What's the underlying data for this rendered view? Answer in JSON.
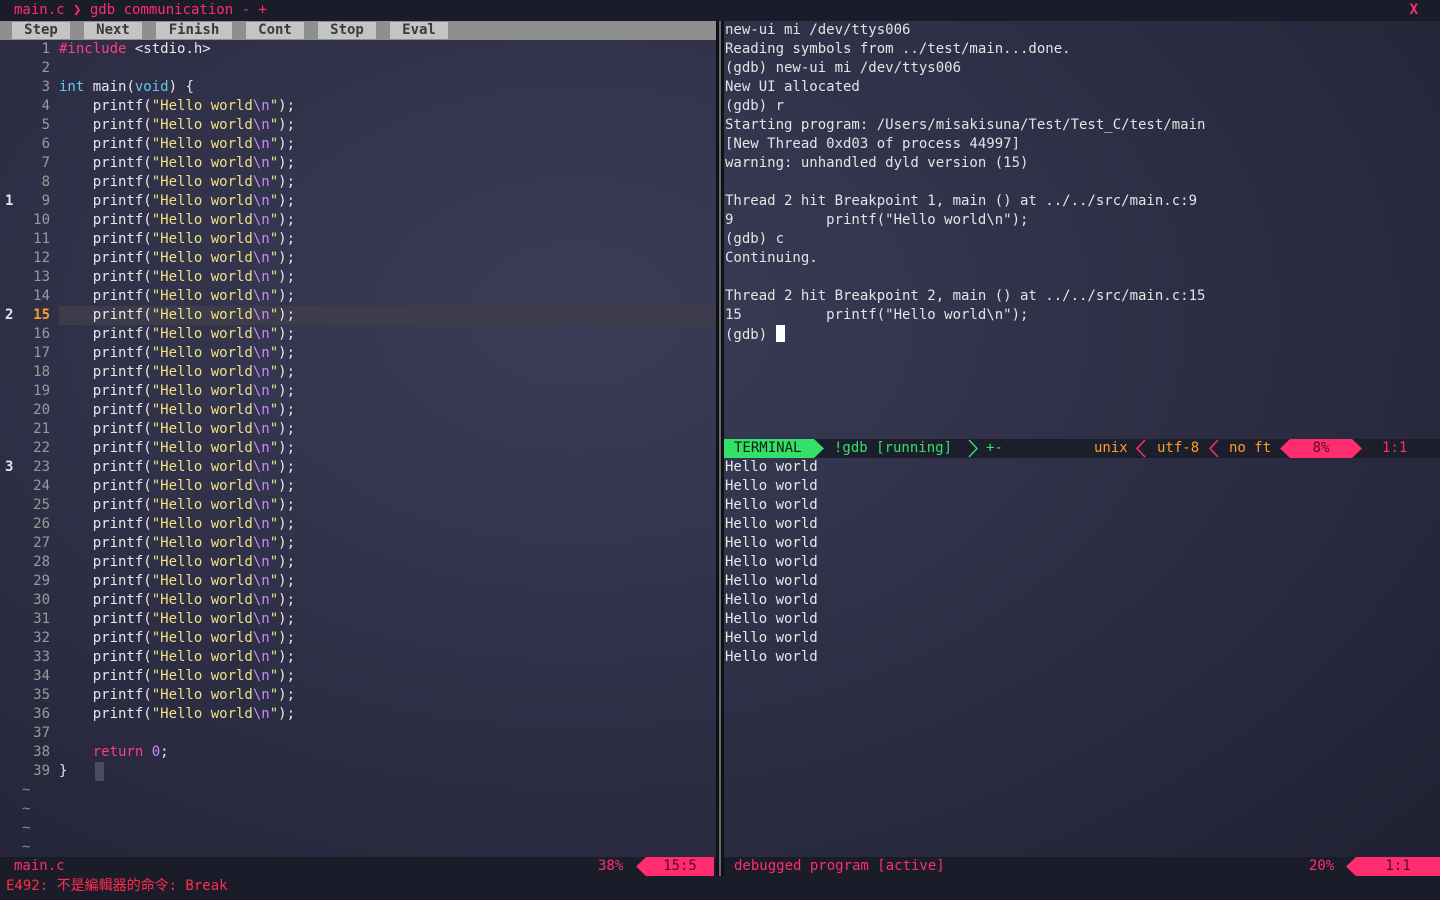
{
  "tabline": {
    "tab_text": "main.c ❯ gdb communication - +",
    "close_label": "X"
  },
  "toolbar": {
    "buttons": [
      "Step",
      "Next",
      "Finish",
      "Cont",
      "Stop",
      "Eval"
    ]
  },
  "editor": {
    "signs": {
      "9": "1",
      "15": "2",
      "23": "3"
    },
    "current_line": 15,
    "last_line": 39,
    "tilde": "~",
    "include_kw": "#include",
    "include_file": " <stdio.h>",
    "main_type": "int",
    "main_sig": " main(",
    "void_kw": "void",
    "main_end": ") {",
    "printf_pre": "    printf(",
    "printf_str": "\"Hello world",
    "printf_esc": "\\n",
    "printf_str_end": "\"",
    "printf_end": ");",
    "return_indent": "    ",
    "return_kw": "return",
    "return_num": "0",
    "return_end": ";",
    "close_brace": "}"
  },
  "gdb": {
    "lines": [
      "new-ui mi /dev/ttys006",
      "Reading symbols from ../test/main...done.",
      "(gdb) new-ui mi /dev/ttys006",
      "New UI allocated",
      "(gdb) r",
      "Starting program: /Users/misakisuna/Test/Test_C/test/main",
      "[New Thread 0xd03 of process 44997]",
      "warning: unhandled dyld version (15)",
      "",
      "Thread 2 hit Breakpoint 1, main () at ../../src/main.c:9",
      "9           printf(\"Hello world\\n\");",
      "(gdb) c",
      "Continuing.",
      "",
      "Thread 2 hit Breakpoint 2, main () at ../../src/main.c:15",
      "15          printf(\"Hello world\\n\");"
    ],
    "prompt": "(gdb) "
  },
  "terminal_status": {
    "mode": "TERMINAL",
    "name": "!gdb [running]",
    "flags": "+-",
    "fileformat": "unix",
    "encoding": "utf-8",
    "filetype": "no ft",
    "percent": "8%",
    "position": "1:1"
  },
  "terminal_output": {
    "lines": [
      "Hello world",
      "Hello world",
      "Hello world",
      "Hello world",
      "Hello world",
      "Hello world",
      "Hello world",
      "Hello world",
      "Hello world",
      "Hello world",
      "Hello world"
    ]
  },
  "status_left": {
    "filename": "main.c",
    "percent": "38%",
    "position": "15:5"
  },
  "status_right": {
    "name": "debugged program [active]",
    "percent": "20%",
    "position": "1:1"
  },
  "cmdline": {
    "message": "E492: 不是編輯器的命令: Break"
  },
  "colors": {
    "accent": "#ff2d70",
    "terminal_green": "#33e06a",
    "toolbar_gray": "#8f8f8f",
    "current_line_number": "#ff9c2a"
  }
}
